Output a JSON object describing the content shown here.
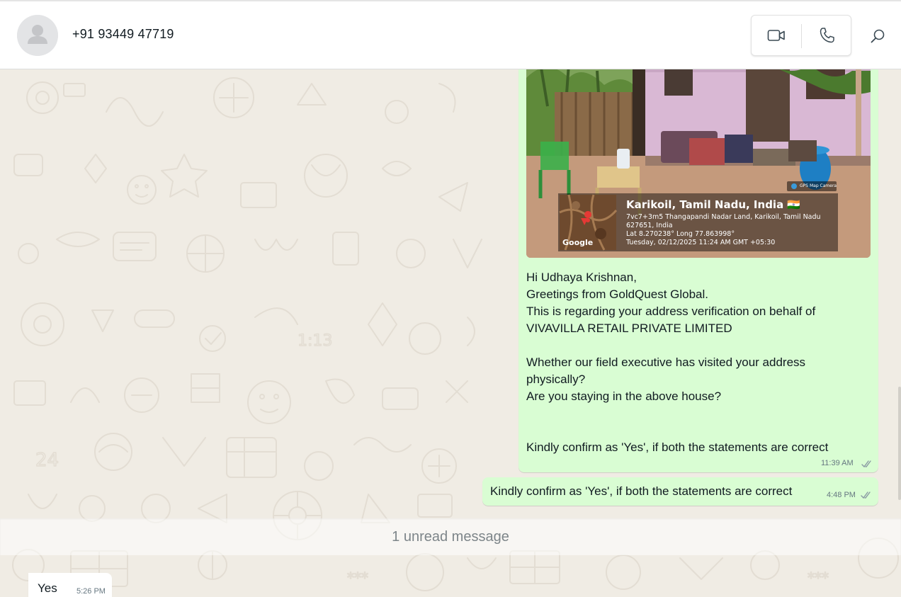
{
  "header": {
    "contact_name": "+91 93449 47719",
    "avatar_icon": "default-person-icon",
    "video_call_icon": "video-camera-icon",
    "voice_call_icon": "phone-icon",
    "search_icon": "search-icon"
  },
  "photo_overlay": {
    "location_title": "Karikoil, Tamil Nadu, India 🇮🇳",
    "address_line_1": "7vc7+3m5 Thangapandi Nadar Land, Karikoil, Tamil Nadu",
    "address_line_2": "627651, India",
    "coordinates": "Lat 8.270238° Long 77.863998°",
    "timestamp": "Tuesday, 02/12/2025 11:24 AM GMT +05:30",
    "map_label": "Google",
    "camera_badge": "GPS Map Camera"
  },
  "messages": [
    {
      "direction": "outgoing",
      "lines": [
        "Hi Udhaya Krishnan,",
        "Greetings from GoldQuest Global.",
        "This is regarding your address verification on behalf of",
        "VIVAVILLA RETAIL PRIVATE LIMITED",
        "",
        "Whether our field executive has visited your address",
        "physically?",
        "Are you staying in the above house?",
        "",
        "",
        "Kindly confirm as 'Yes', if both the statements are correct"
      ],
      "time": "11:39 AM",
      "status": "read"
    },
    {
      "direction": "outgoing",
      "text": "Kindly confirm as 'Yes', if both the statements are correct",
      "time": "4:48 PM",
      "status": "read"
    },
    {
      "direction": "incoming",
      "text": "Yes",
      "time": "5:26 PM"
    }
  ],
  "unread_banner": "1 unread message",
  "colors": {
    "outgoing_bubble": "#d9fdd3",
    "incoming_bubble": "#ffffff",
    "chat_background": "#f0ece4",
    "meta_text": "#667781"
  }
}
